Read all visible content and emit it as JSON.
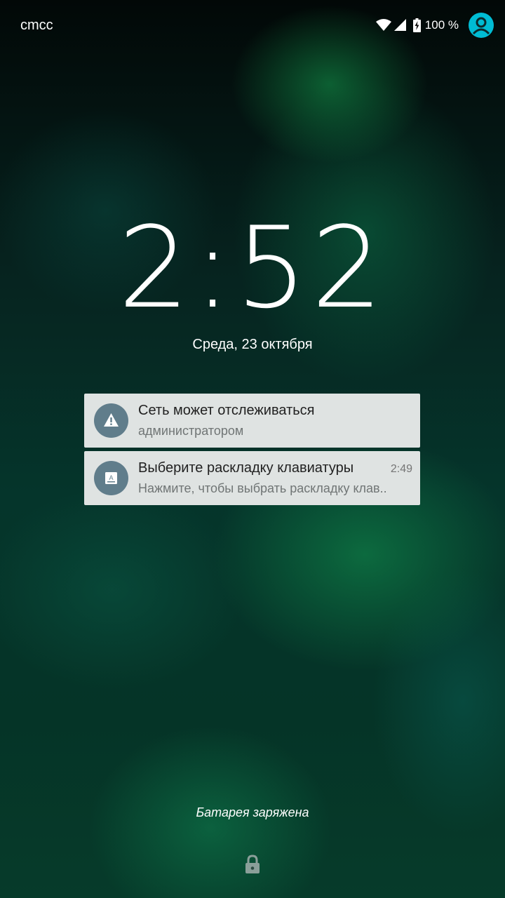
{
  "status_bar": {
    "carrier": "cmcc",
    "battery_percent": "100 %",
    "icons": [
      "wifi-icon",
      "cell-signal-icon",
      "battery-charging-icon",
      "user-avatar-icon"
    ],
    "avatar_color": "#00bcd4"
  },
  "lockscreen": {
    "clock_hours": "2",
    "clock_minutes": "52",
    "date": "Среда, 23 октября",
    "battery_status": "Батарея заряжена",
    "lock_icon": "lock-icon"
  },
  "notifications": [
    {
      "icon": "warning-icon",
      "title": "Сеть может отслеживаться",
      "text": "администратором",
      "time": ""
    },
    {
      "icon": "keyboard-icon",
      "title": "Выберите раскладку клавиатуры",
      "text": "Нажмите, чтобы выбрать раскладку клав..",
      "time": "2:49"
    }
  ],
  "colors": {
    "notification_bg": "#dfe3e2",
    "notification_icon_bg": "#607d8b"
  }
}
